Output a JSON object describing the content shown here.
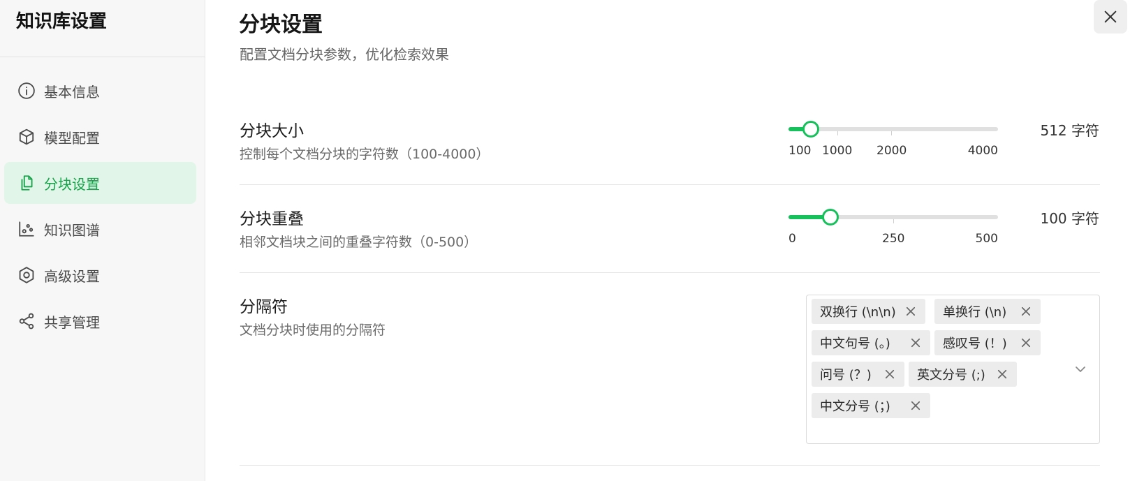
{
  "sidebar": {
    "title": "知识库设置",
    "items": [
      {
        "label": "基本信息",
        "icon": "info-icon"
      },
      {
        "label": "模型配置",
        "icon": "cube-icon"
      },
      {
        "label": "分块设置",
        "icon": "copy-document-icon",
        "active": true
      },
      {
        "label": "知识图谱",
        "icon": "graph-icon"
      },
      {
        "label": "高级设置",
        "icon": "hexagon-gear-icon"
      },
      {
        "label": "共享管理",
        "icon": "share-icon"
      }
    ]
  },
  "header": {
    "title": "分块设置",
    "subtitle": "配置文档分块参数，优化检索效果"
  },
  "settings": {
    "chunk_size": {
      "title": "分块大小",
      "desc": "控制每个文档分块的字符数（100-4000）",
      "value_label": "512 字符",
      "value": 512,
      "min": 100,
      "max": 4000,
      "marks": [
        "100",
        "1000",
        "2000",
        "4000"
      ]
    },
    "chunk_overlap": {
      "title": "分块重叠",
      "desc": "相邻文档块之间的重叠字符数（0-500）",
      "value_label": "100 字符",
      "value": 100,
      "min": 0,
      "max": 500,
      "marks": [
        "0",
        "250",
        "500"
      ]
    },
    "separators": {
      "title": "分隔符",
      "desc": "文档分块时使用的分隔符",
      "tags": [
        "双换行 (\\n\\n)",
        "单换行 (\\n)",
        "中文句号 (。)",
        "感叹号 (！)",
        "问号 (？)",
        "英文分号 (;)",
        "中文分号 (；)"
      ]
    }
  },
  "colors": {
    "accent": "#16c05a",
    "active_bg": "#e1f5e8",
    "active_text": "#16a34a"
  }
}
